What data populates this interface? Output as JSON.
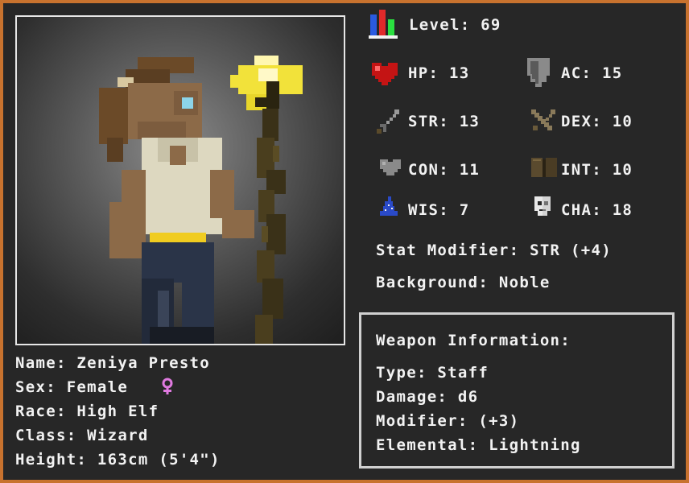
{
  "character": {
    "name_label": "Name: Zeniya Presto",
    "sex_label": "Sex: Female",
    "race_label": "Race: High Elf",
    "class_label": "Class: Wizard",
    "height_label": "Height: 163cm (5'4\")"
  },
  "stats": {
    "level": "Level: 69",
    "hp": "HP: 13",
    "ac": "AC: 15",
    "str": "STR: 13",
    "dex": "DEX: 10",
    "con": "CON: 11",
    "int": "INT: 10",
    "wis": "WIS: 7",
    "cha": "CHA: 18",
    "stat_modifier": "Stat Modifier: STR (+4)",
    "background": "Background: Noble"
  },
  "weapon": {
    "title": "Weapon Information:",
    "type": "Type: Staff",
    "damage": "Damage: d6",
    "modifier": "Modifier: (+3)",
    "elemental": "Elemental: Lightning"
  },
  "icons": {
    "level": "bar-chart-icon",
    "hp": "heart-icon",
    "ac": "shield-icon",
    "str": "sword-icon",
    "dex": "crossed-daggers-icon",
    "con": "grey-heart-icon",
    "int": "book-icon",
    "wis": "wizard-hat-icon",
    "cha": "mask-icon",
    "sex": "female-symbol-icon"
  },
  "colors": {
    "frame": "#c8722e",
    "panel": "#272727",
    "text": "#f2f2f2",
    "female_symbol": "#e07ae0"
  }
}
